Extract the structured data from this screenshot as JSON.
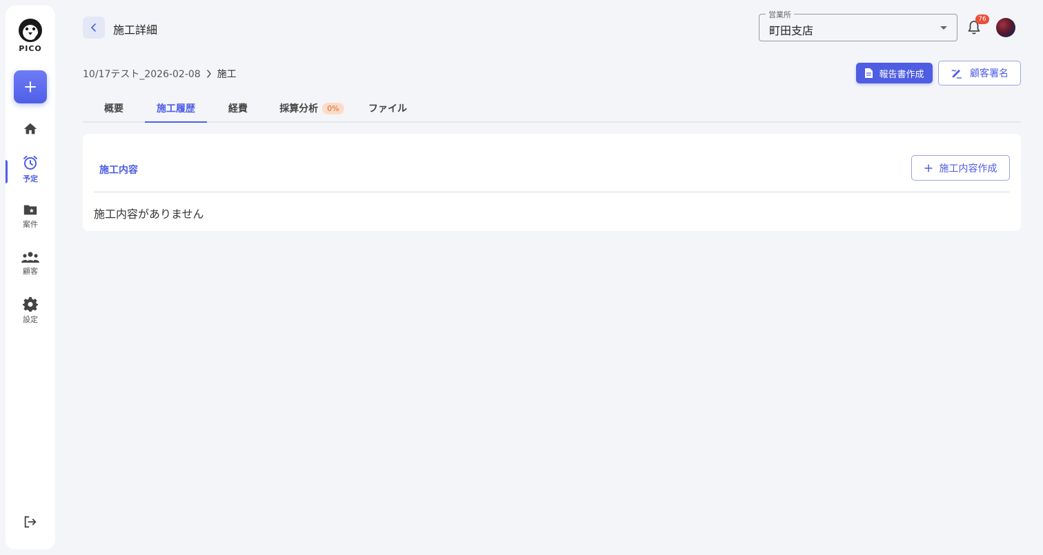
{
  "sidebar": {
    "logo_text": "PICO",
    "items": [
      {
        "label": "",
        "icon": "home-icon"
      },
      {
        "label": "予定",
        "icon": "alarm-clock-icon",
        "active": true
      },
      {
        "label": "案件",
        "icon": "folder-star-icon"
      },
      {
        "label": "顧客",
        "icon": "people-icon"
      },
      {
        "label": "設定",
        "icon": "gear-icon"
      }
    ],
    "logout_icon": "logout-icon"
  },
  "header": {
    "title": "施工詳細",
    "branch_legend": "営業所",
    "branch_value": "町田支店",
    "notification_count": "76"
  },
  "breadcrumb": {
    "project": "10/17テスト_2026-02-08",
    "current": "施工"
  },
  "actions": {
    "report_label": "報告書作成",
    "sign_label": "顧客署名"
  },
  "tabs": [
    {
      "label": "概要"
    },
    {
      "label": "施工履歴",
      "active": true
    },
    {
      "label": "経費"
    },
    {
      "label": "採算分析",
      "badge": "0%"
    },
    {
      "label": "ファイル"
    }
  ],
  "card": {
    "title": "施工内容",
    "add_label": "施工内容作成",
    "empty_text": "施工内容がありません"
  },
  "colors": {
    "accent": "#4e5de4",
    "background": "#f4f5f8",
    "badge": "#e8503a"
  }
}
